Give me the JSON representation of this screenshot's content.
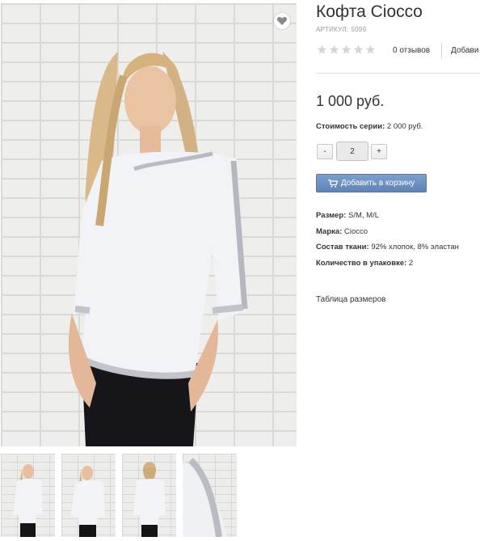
{
  "product": {
    "title": "Кофта Ciocco",
    "sku_label": "АРТИКУЛ:",
    "sku_value": "5099",
    "rating": 0,
    "rating_max": 5,
    "reviews_label": "0 отзывов",
    "add_review_label": "Добави",
    "price": "1 000 руб.",
    "series_label": "Стоимость серии:",
    "series_value": "2 000 руб.",
    "quantity": "2",
    "minus_label": "-",
    "plus_label": "+",
    "add_to_cart_label": "Добавить в корзину",
    "properties": [
      {
        "name": "Размер:",
        "value": "S/M, M/L"
      },
      {
        "name": "Марка:",
        "value": "Ciocco"
      },
      {
        "name": "Состав ткани:",
        "value": "92% хлопок, 8% эластан"
      },
      {
        "name": "Количество в упаковке:",
        "value": "2"
      }
    ],
    "size_table_label": "Таблица размеров"
  },
  "gallery": {
    "main_image": "model-wearing-white-top-photo",
    "thumbnails": [
      "front-view-thumbnail",
      "front-view-thumbnail",
      "back-view-thumbnail",
      "sleeve-detail-thumbnail"
    ]
  },
  "icons": {
    "wishlist": "heart-icon",
    "cart": "cart-icon",
    "star": "star-icon"
  },
  "colors": {
    "button_blue": "#6a8fc4",
    "star_empty": "#d6d6d6",
    "text": "#333333",
    "muted": "#9a9a9a"
  }
}
